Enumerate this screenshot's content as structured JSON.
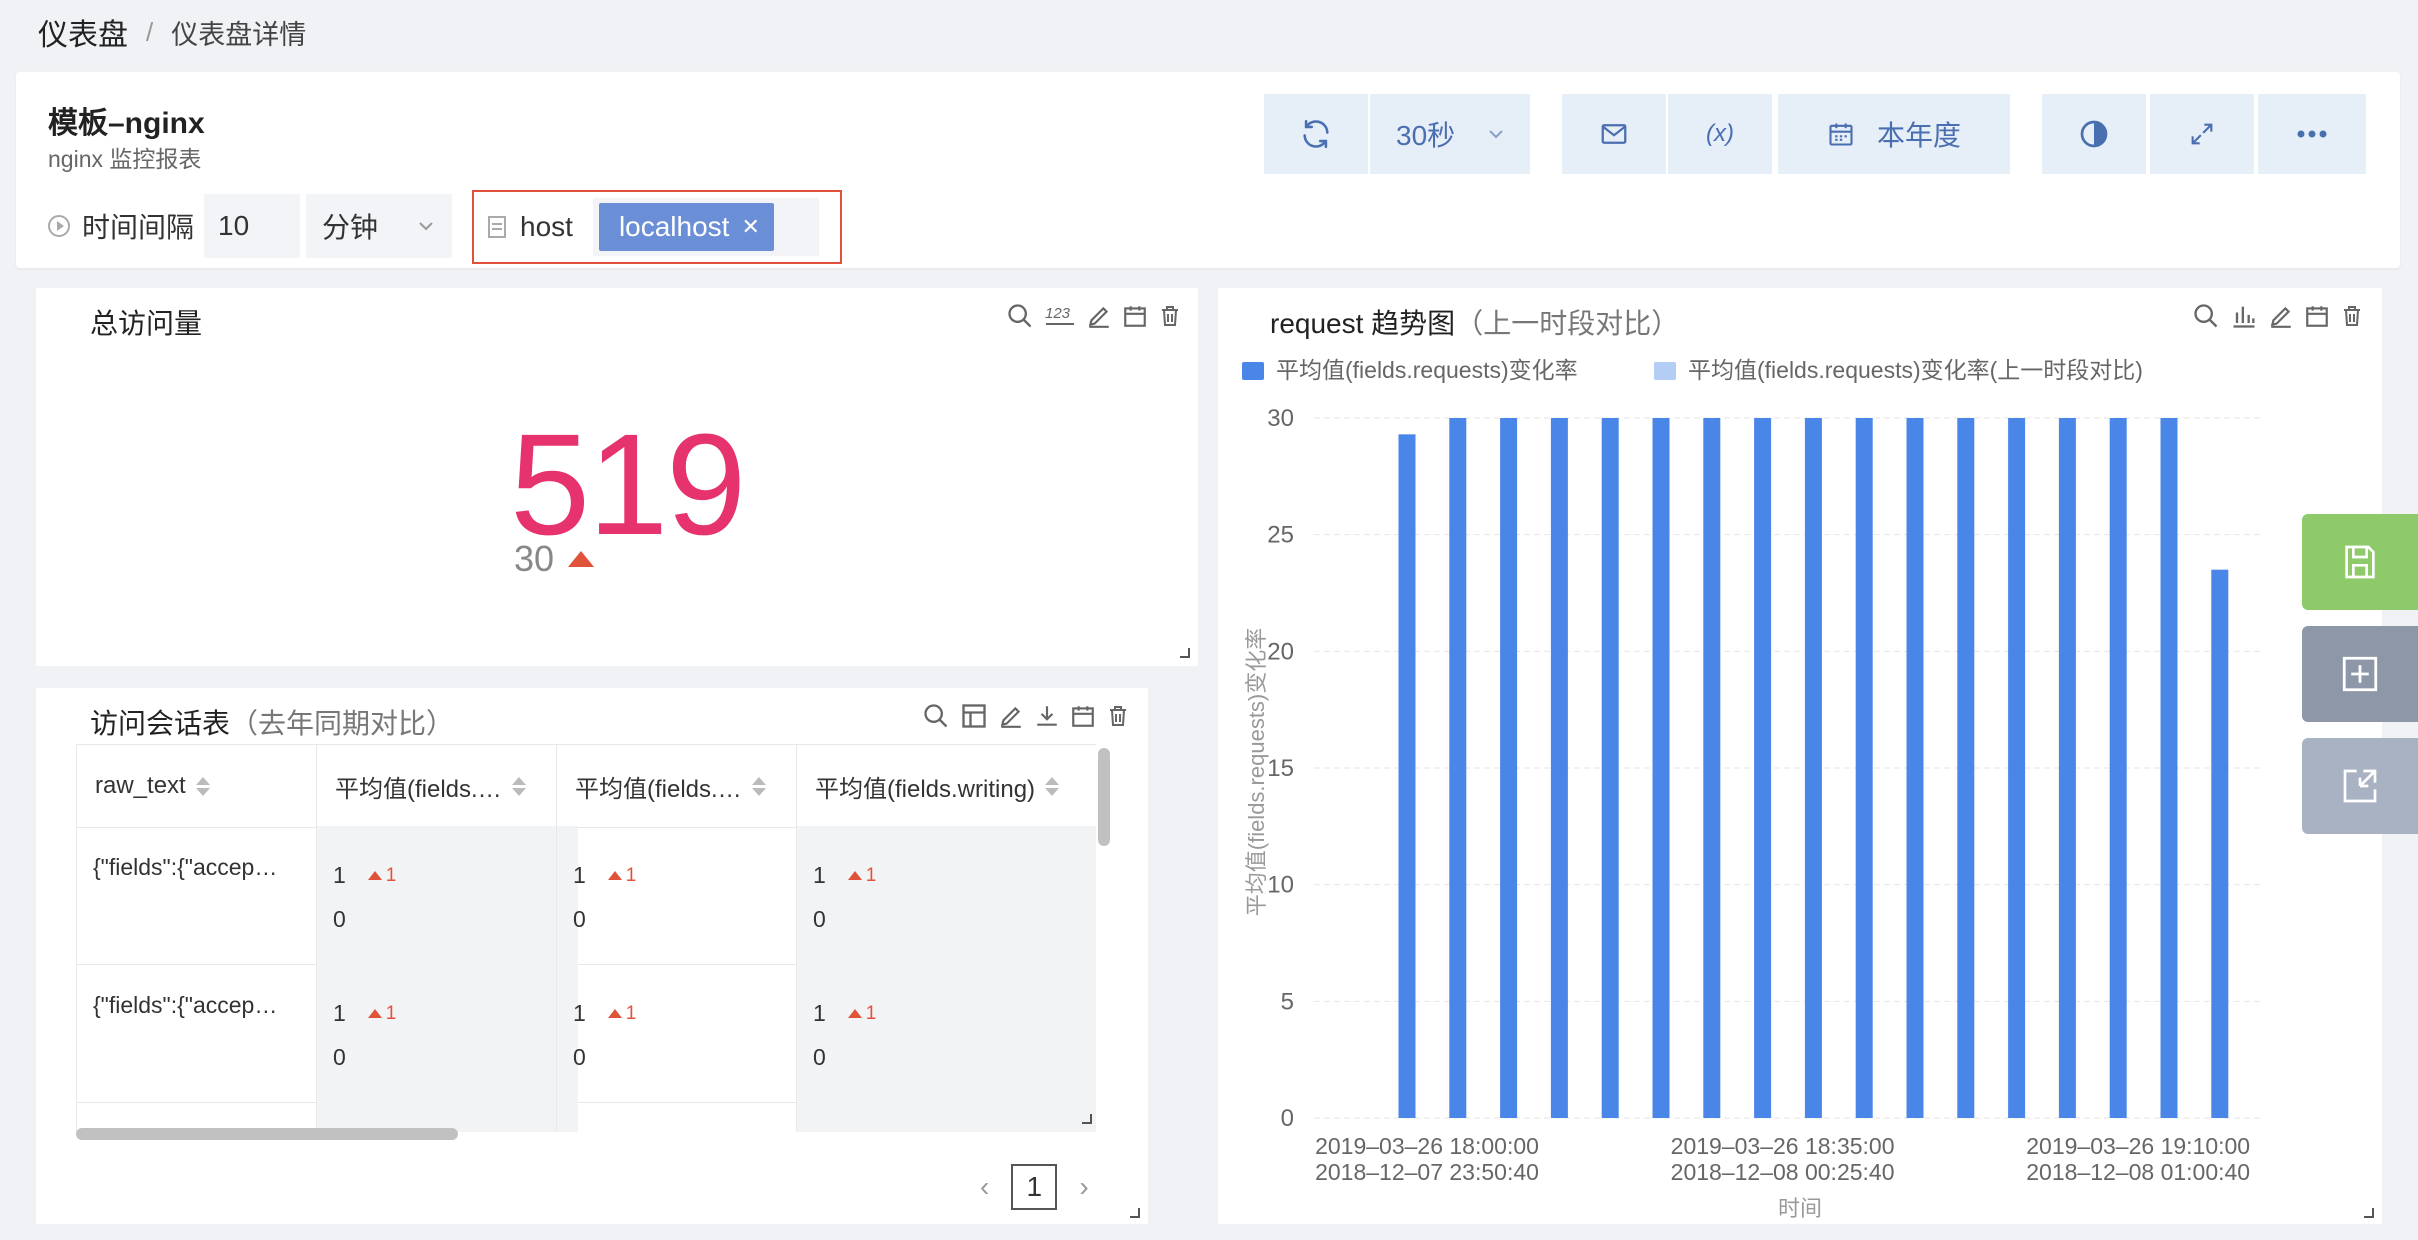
{
  "breadcrumb": {
    "root": "仪表盘",
    "separator": "/",
    "current": "仪表盘详情"
  },
  "header": {
    "title": "模板–nginx",
    "subtitle": "nginx 监控报表",
    "refresh_interval": "30秒",
    "time_range": "本年度"
  },
  "filters": {
    "interval_label": "时间间隔",
    "interval_value": "10",
    "interval_unit": "分钟",
    "host_label": "host",
    "host_tag": "localhost"
  },
  "total_panel": {
    "title": "总访问量",
    "value": "519",
    "delta": "30"
  },
  "session_table": {
    "title": "访问会话表",
    "title_suffix": "（去年同期对比）",
    "columns": [
      "raw_text",
      "平均值(fields.…",
      "平均值(fields.…",
      "平均值(fields.writing)"
    ],
    "rows": [
      {
        "raw": "{\"fields\":{\"accep…",
        "cells": [
          {
            "value": "1",
            "delta": "1",
            "previous": "0"
          },
          {
            "value": "1",
            "delta": "1",
            "previous": "0"
          },
          {
            "value": "1",
            "delta": "1",
            "previous": "0"
          }
        ]
      },
      {
        "raw": "{\"fields\":{\"accep…",
        "cells": [
          {
            "value": "1",
            "delta": "1",
            "previous": "0"
          },
          {
            "value": "1",
            "delta": "1",
            "previous": "0"
          },
          {
            "value": "1",
            "delta": "1",
            "previous": "0"
          }
        ]
      }
    ],
    "page": "1"
  },
  "colors": {
    "accent": "#4a86e8",
    "big_number": "#e6336d",
    "up_arrow": "#e0523a",
    "legend_prev": "#b3cdf5",
    "save_fab": "#8fca6a",
    "add_fab": "#8d97a8",
    "exit_fab": "#a9b2c3"
  },
  "icons": {
    "toolbar": [
      "refresh-icon",
      "chevron-down-icon",
      "mail-icon",
      "variable-icon",
      "calendar-icon",
      "contrast-icon",
      "expand-icon",
      "more-icon"
    ],
    "fabs": [
      "save-icon",
      "add-panel-icon",
      "exit-icon"
    ]
  },
  "chart_data": {
    "type": "bar",
    "title": "request 趋势图",
    "title_suffix": "（上一时段对比）",
    "ylabel": "平均值(fields.requests)变化率",
    "xlabel": "时间",
    "ylim": [
      0,
      30
    ],
    "yticks": [
      0,
      5,
      10,
      15,
      20,
      25,
      30
    ],
    "grid": true,
    "legend_position": "top-left",
    "x_tick_labels": [
      {
        "current": "2019–03–26 18:00:00",
        "previous": "2018–12–07 23:50:40"
      },
      {
        "current": "2019–03–26 18:35:00",
        "previous": "2018–12–08 00:25:40"
      },
      {
        "current": "2019–03–26 19:10:00",
        "previous": "2018–12–08 01:00:40"
      }
    ],
    "series": [
      {
        "name": "平均值(fields.requests)变化率",
        "color": "#4a86e8",
        "values": [
          29.3,
          30,
          30,
          30,
          30,
          30,
          30,
          30,
          30,
          30,
          30,
          30,
          30,
          30,
          30,
          30,
          23.5
        ]
      },
      {
        "name": "平均值(fields.requests)变化率(上一时段对比)",
        "color": "#b3cdf5",
        "values": []
      }
    ]
  }
}
